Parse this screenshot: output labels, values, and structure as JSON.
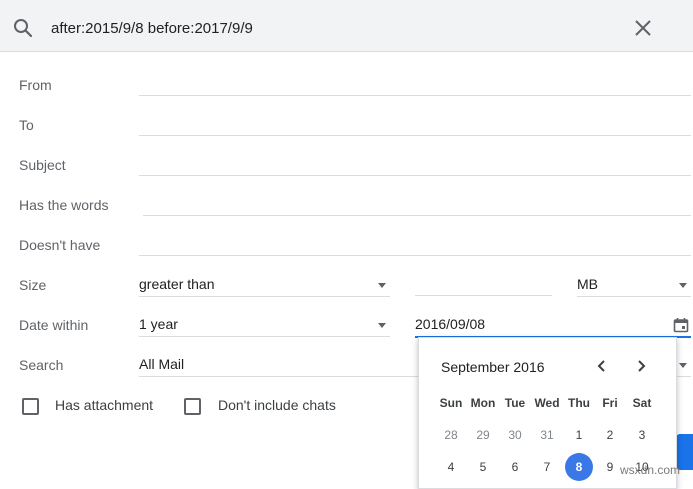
{
  "search": {
    "query": "after:2015/9/8 before:2017/9/9"
  },
  "form": {
    "from_label": "From",
    "to_label": "To",
    "subject_label": "Subject",
    "has_words_label": "Has the words",
    "doesnt_have_label": "Doesn't have",
    "size_label": "Size",
    "size_operator": "greater than",
    "size_value": "",
    "size_unit": "MB",
    "date_within_label": "Date within",
    "date_within_value": "1 year",
    "date_value": "2016/09/08",
    "search_label": "Search",
    "search_in": "All Mail",
    "has_attachment_label": "Has attachment",
    "no_chats_label": "Don't include chats"
  },
  "calendar": {
    "month_label": "September 2016",
    "weekdays": [
      "Sun",
      "Mon",
      "Tue",
      "Wed",
      "Thu",
      "Fri",
      "Sat"
    ],
    "week1": [
      "28",
      "29",
      "30",
      "31",
      "1",
      "2",
      "3"
    ],
    "week2": [
      "4",
      "5",
      "6",
      "7",
      "8",
      "9",
      "10"
    ],
    "selected_day": "8"
  },
  "watermark": "wsxdn.com",
  "colors": {
    "accent": "#1a73e8",
    "selected": "#3b78e7",
    "topbar": "#f1f3f4"
  }
}
